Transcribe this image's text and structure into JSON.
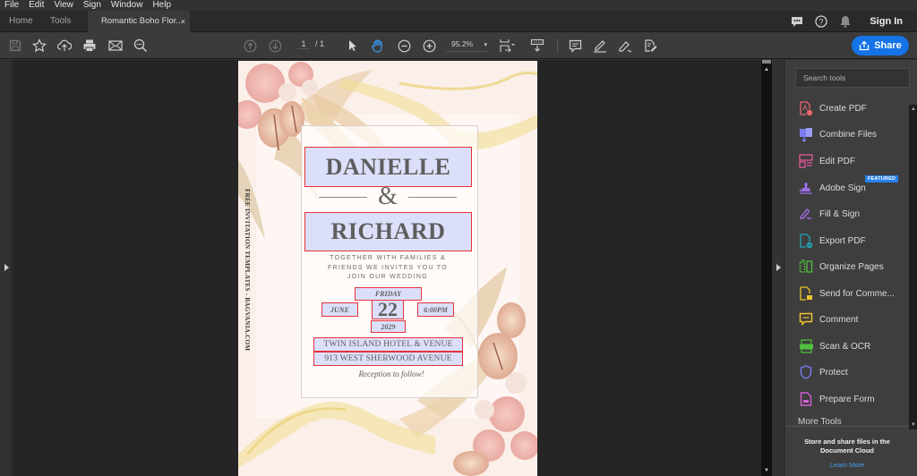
{
  "menu": [
    "File",
    "Edit",
    "View",
    "Sign",
    "Window",
    "Help"
  ],
  "tabs": {
    "home": "Home",
    "tools": "Tools",
    "document": "Romantic Boho Flor...",
    "close_symbol": "×"
  },
  "header": {
    "sign_in": "Sign In",
    "icons": [
      "chat-icon",
      "help-icon",
      "bell-icon"
    ]
  },
  "toolbar": {
    "current_page": "1",
    "total_pages": "/ 1",
    "zoom": "95.2%",
    "share": "Share",
    "caret": "▾"
  },
  "document": {
    "bride": "DANIELLE",
    "ampersand": "&",
    "groom": "RICHARD",
    "invite_lines": [
      "TOGETHER WITH FAMILIES &",
      "FRIENDS WE INVITES YOU TO",
      "JOIN OUR WEDDING"
    ],
    "day": "FRIDAY",
    "month": "JUNE",
    "date": "22",
    "time": "6:00PM",
    "year": "2029",
    "venue_name": "TWIN ISLAND HOTEL & VENUE",
    "venue_address": "913 WEST SHERWOOD AVENUE",
    "reception": "Reception to follow!",
    "side_text": "FREE INVITATION TEMPLATES - BAGVANIA.COM"
  },
  "tools_pane": {
    "search_placeholder": "Search tools",
    "items": [
      {
        "label": "Create PDF",
        "color": "#e8676b"
      },
      {
        "label": "Combine Files",
        "color": "#7b7cf0"
      },
      {
        "label": "Edit PDF",
        "color": "#e55a9c"
      },
      {
        "label": "Adobe Sign",
        "color": "#9a6ee8"
      },
      {
        "label": "Fill & Sign",
        "color": "#a56de2"
      },
      {
        "label": "Export PDF",
        "color": "#1fa7b8"
      },
      {
        "label": "Organize Pages",
        "color": "#4fc13c"
      },
      {
        "label": "Send for Comme...",
        "color": "#f0c52d"
      },
      {
        "label": "Comment",
        "color": "#f0c52d"
      },
      {
        "label": "Scan & OCR",
        "color": "#4fc13c"
      },
      {
        "label": "Protect",
        "color": "#7b7cf0"
      },
      {
        "label": "Prepare Form",
        "color": "#d65ed6"
      }
    ],
    "featured_badge": "FEATURED",
    "more_tools": "More Tools",
    "footer_message": "Store and share files in the Document Cloud",
    "learn_more": "Learn More"
  },
  "colors": {
    "accent": "#1473e6",
    "field_fill": "#dcdff9",
    "field_border": "#e8323c"
  }
}
